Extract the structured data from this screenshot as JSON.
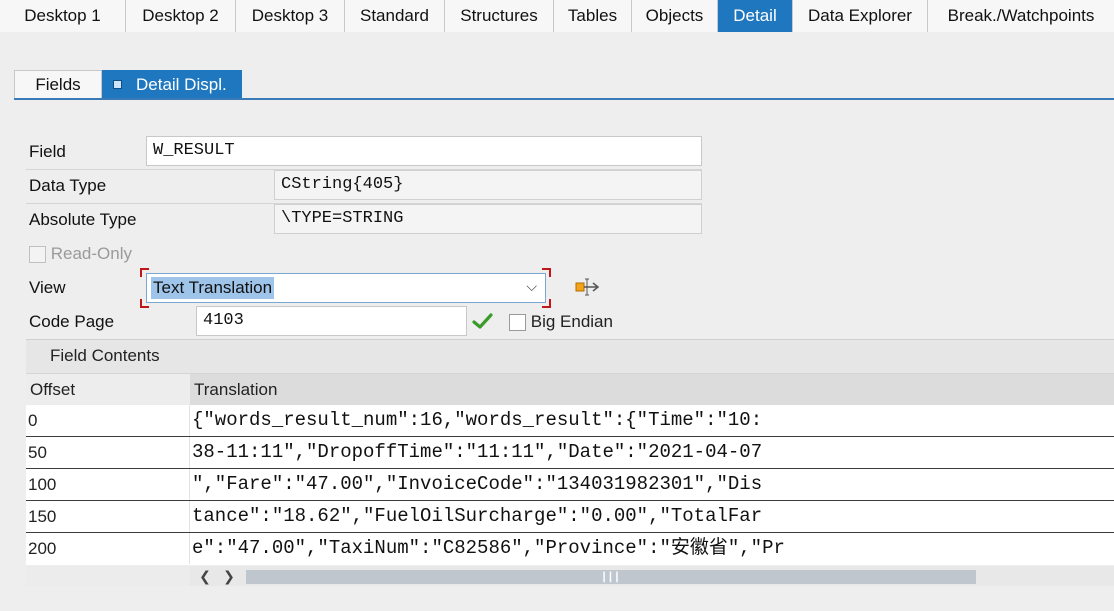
{
  "top_tabs": [
    {
      "label": "Desktop 1",
      "active": false
    },
    {
      "label": "Desktop 2",
      "active": false
    },
    {
      "label": "Desktop 3",
      "active": false
    },
    {
      "label": "Standard",
      "active": false
    },
    {
      "label": "Structures",
      "active": false
    },
    {
      "label": "Tables",
      "active": false
    },
    {
      "label": "Objects",
      "active": false
    },
    {
      "label": "Detail",
      "active": true
    },
    {
      "label": "Data Explorer",
      "active": false
    },
    {
      "label": "Break./Watchpoints",
      "active": false
    }
  ],
  "sub_tabs": {
    "fields": "Fields",
    "detail_display": "Detail Displ."
  },
  "form": {
    "field_label": "Field",
    "field_value": "W_RESULT",
    "data_type_label": "Data Type",
    "data_type_value": "CString{405}",
    "absolute_type_label": "Absolute Type",
    "absolute_type_value": "\\TYPE=STRING",
    "read_only_label": "Read-Only",
    "view_label": "View",
    "view_value": "Text Translation",
    "code_page_label": "Code Page",
    "code_page_value": "4103",
    "big_endian_label": "Big Endian"
  },
  "contents": {
    "title": "Field Contents",
    "col_offset": "Offset",
    "col_translation": "Translation",
    "rows": [
      {
        "offset": "0",
        "text": "{\"words_result_num\":16,\"words_result\":{\"Time\":\"10:"
      },
      {
        "offset": "50",
        "text": "38-11:11\",\"DropoffTime\":\"11:11\",\"Date\":\"2021-04-07"
      },
      {
        "offset": "100",
        "text": "\",\"Fare\":\"47.00\",\"InvoiceCode\":\"134031982301\",\"Dis"
      },
      {
        "offset": "150",
        "text": "tance\":\"18.62\",\"FuelOilSurcharge\":\"0.00\",\"TotalFar"
      },
      {
        "offset": "200",
        "text": "e\":\"47.00\",\"TaxiNum\":\"C82586\",\"Province\":\"安徽省\",\"Pr"
      }
    ]
  },
  "icons": {
    "detail_tab": "square-bullet-icon",
    "view_action": "transfer-icon",
    "code_page_ok": "checkmark-icon",
    "scroll_left": "chevron-left-icon",
    "scroll_right": "chevron-right-icon"
  },
  "colors": {
    "accent": "#1f78bf",
    "selection": "#9ec4ea",
    "check_green": "#3a9a2a",
    "focus_red": "#c01818"
  }
}
